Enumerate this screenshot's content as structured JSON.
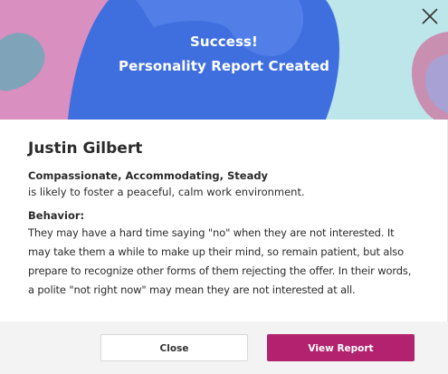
{
  "banner": {
    "title_line1": "Success!",
    "title_line2": "Personality Report Created"
  },
  "colors": {
    "banner_blue": "#3f6fdf",
    "banner_pink": "#d98fbf",
    "banner_teal": "#bde6ea",
    "primary_button": "#b3226e"
  },
  "icons": {
    "close": "close-icon"
  },
  "report": {
    "name": "Justin Gilbert",
    "traits": "Compassionate, Accommodating, Steady",
    "traits_desc": "is likely to foster a peaceful, calm work environment.",
    "behavior_label": "Behavior:",
    "behavior_lines": [
      "They may have a hard time saying \"no\" when they are not interested. It",
      "may take them a while to make up their mind, so remain patient, but also",
      "prepare to recognize other forms of them rejecting the offer. In their words,",
      "a polite \"not right now\" may mean they are not interested at all."
    ]
  },
  "footer": {
    "close_label": "Close",
    "view_label": "View Report"
  }
}
